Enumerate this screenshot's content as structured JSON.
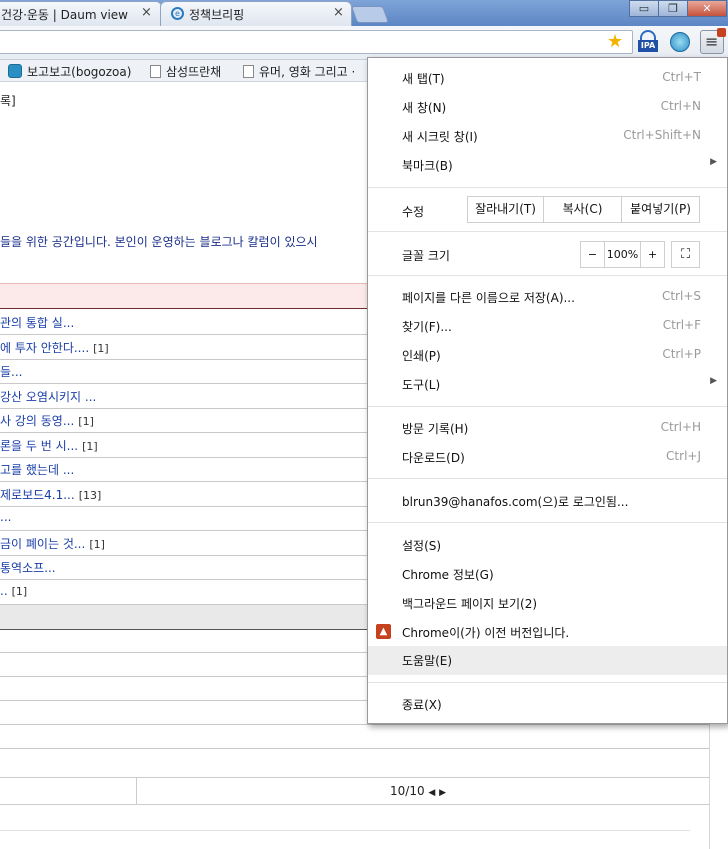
{
  "tabs": [
    {
      "title": "건강·운동 | Daum view",
      "close": "×"
    },
    {
      "title": "정책브리핑",
      "close": "×"
    }
  ],
  "window_controls": {
    "minimize": "▭",
    "restore": "❐",
    "close": "✕"
  },
  "toolbar": {
    "ipa_label": "IPA",
    "star": "★",
    "menu_glyph": "≡"
  },
  "bookmarks": [
    {
      "label": "보고보고(bogozoa)"
    },
    {
      "label": "삼성뜨란채"
    },
    {
      "label": "유머, 영화 그리고 ·"
    }
  ],
  "page": {
    "top_label": "록]",
    "intro": "들을 위한 공간입니다. 본인이 운영하는 블로그나 칼럼이 있으시",
    "rows": [
      {
        "text": "관의 통합 실...",
        "count": ""
      },
      {
        "text": "에 투자 안한다....",
        "count": "[1]"
      },
      {
        "text": "들...",
        "count": ""
      },
      {
        "text": "강산 오염시키지 ...",
        "count": ""
      },
      {
        "text": "사 강의 동영...",
        "count": "[1]"
      },
      {
        "text": "론을 두 번 시...",
        "count": "[1]"
      },
      {
        "text": "고를 했는데 ...",
        "count": ""
      },
      {
        "text": "제로보드4.1...",
        "count": "[13]"
      },
      {
        "text": "...",
        "count": ""
      },
      {
        "text": "금이 폐이는 것...",
        "count": "[1]"
      },
      {
        "text": "통역소프...",
        "count": ""
      },
      {
        "text": "..",
        "count": "[1]"
      }
    ],
    "pager": {
      "text": "10/10",
      "prev": "◀",
      "next": "▶"
    }
  },
  "menu": {
    "new_tab": {
      "label": "새 탭(T)",
      "accel": "Ctrl+T"
    },
    "new_window": {
      "label": "새 창(N)",
      "accel": "Ctrl+N"
    },
    "incognito": {
      "label": "새 시크릿 창(I)",
      "accel": "Ctrl+Shift+N"
    },
    "bookmarks": {
      "label": "북마크(B)",
      "arrow": "▶"
    },
    "edit": {
      "label": "수정",
      "cut": "잘라내기(T)",
      "copy": "복사(C)",
      "paste": "붙여넣기(P)"
    },
    "zoom": {
      "label": "글꼴 크기",
      "minus": "−",
      "value": "100%",
      "plus": "+",
      "fullscreen": "⛶"
    },
    "save_as": {
      "label": "페이지를 다른 이름으로 저장(A)...",
      "accel": "Ctrl+S"
    },
    "find": {
      "label": "찾기(F)...",
      "accel": "Ctrl+F"
    },
    "print": {
      "label": "인쇄(P)",
      "accel": "Ctrl+P"
    },
    "tools": {
      "label": "도구(L)",
      "arrow": "▶"
    },
    "history": {
      "label": "방문 기록(H)",
      "accel": "Ctrl+H"
    },
    "downloads": {
      "label": "다운로드(D)",
      "accel": "Ctrl+J"
    },
    "signed_in": {
      "label": "blrun39@hanafos.com(으)로 로그인됨..."
    },
    "settings": {
      "label": "설정(S)"
    },
    "about": {
      "label": "Chrome 정보(G)"
    },
    "background_pages": {
      "label": "백그라운드 페이지 보기(2)"
    },
    "update": {
      "label": "Chrome이(가) 이전 버전입니다."
    },
    "help": {
      "label": "도움말(E)"
    },
    "exit": {
      "label": "종료(X)"
    }
  },
  "colors": {
    "tab_strip": "#6b93cf",
    "link": "#1a3ea8",
    "menu_hover": "#ededed",
    "pink_row": "#fce9e9",
    "update_icon": "#c6411d"
  }
}
